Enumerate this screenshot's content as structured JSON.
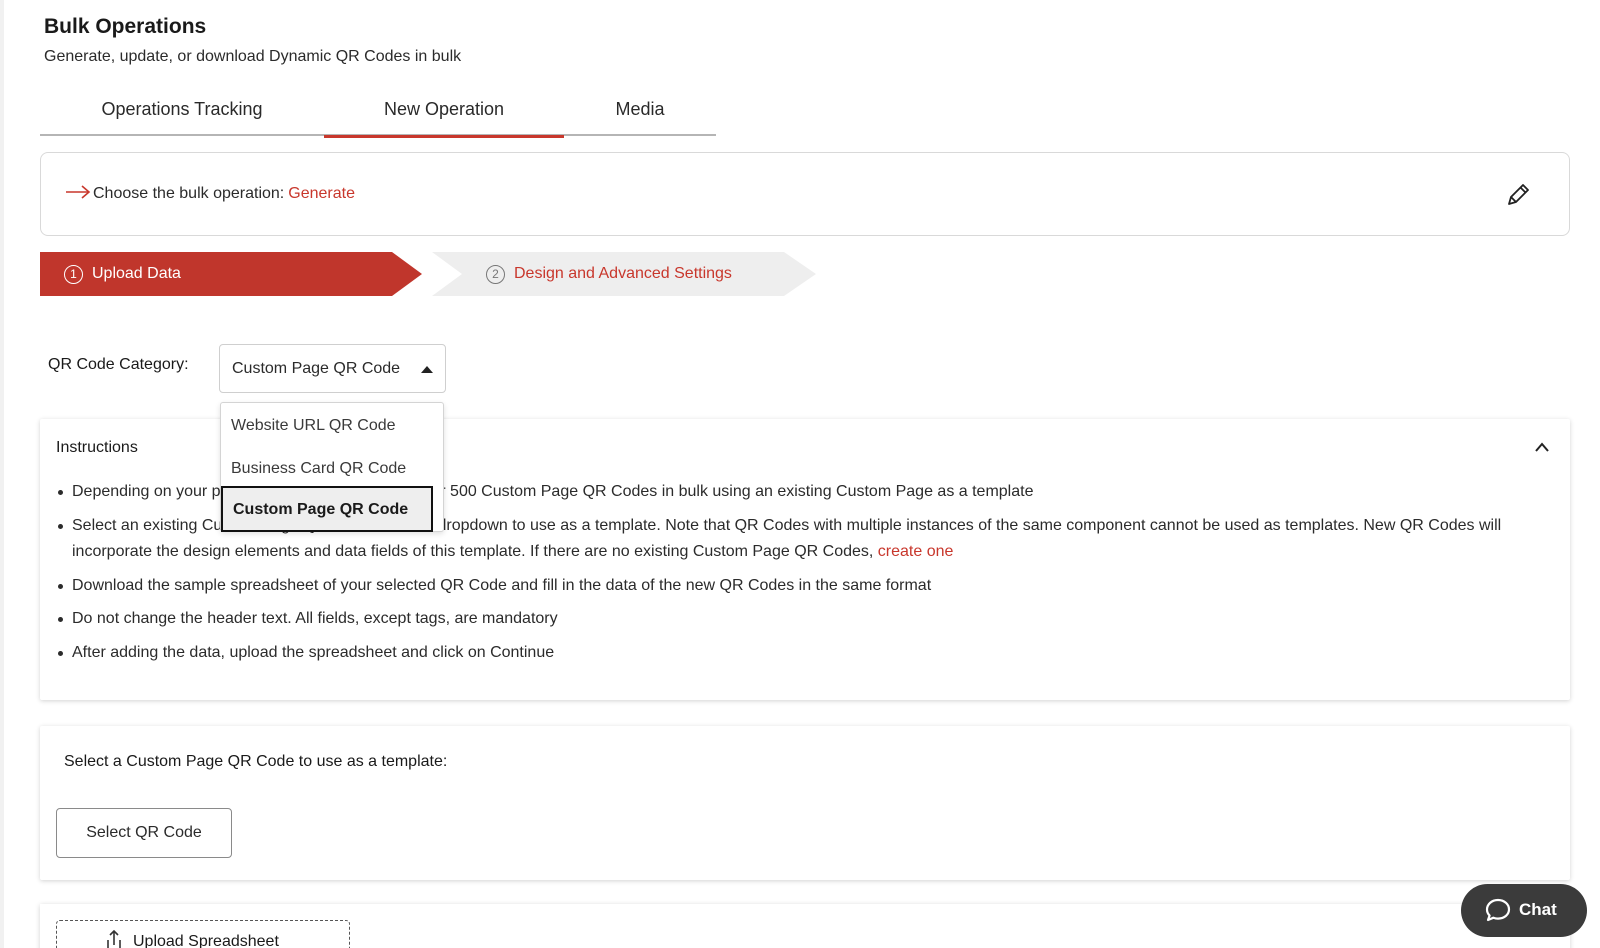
{
  "header": {
    "title": "Bulk Operations",
    "subtitle": "Generate, update, or download Dynamic QR Codes in bulk"
  },
  "tabs": [
    {
      "label": "Operations Tracking",
      "active": false
    },
    {
      "label": "New Operation",
      "active": true
    },
    {
      "label": "Media",
      "active": false
    }
  ],
  "operation": {
    "label": "Choose the bulk operation:",
    "value": "Generate",
    "arrow_icon": "arrow-right-icon",
    "edit_icon": "pencil-icon"
  },
  "stepper": [
    {
      "number": "1",
      "label": "Upload Data",
      "active": true
    },
    {
      "number": "2",
      "label": "Design and Advanced Settings",
      "active": false
    }
  ],
  "category": {
    "label": "QR Code Category:",
    "selected": "Custom Page QR Code",
    "options": [
      "Website URL QR Code",
      "Business Card QR Code",
      "Custom Page QR Code"
    ],
    "highlighted_index": 2
  },
  "instructions": {
    "title": "Instructions",
    "items": [
      "Depending on your plan, you can create up to 100 or 500 Custom Page QR Codes in bulk using an existing Custom Page as a template",
      "Select an existing Custom Page QR Code from the dropdown to use as a template. Note that QR Codes with multiple instances of the same component cannot be used as templates. New QR Codes will incorporate the design elements and data fields of this template. If there are no existing Custom Page QR Codes,",
      "Download the sample spreadsheet of your selected QR Code and fill in the data of the new QR Codes in the same format",
      "Do not change the header text. All fields, except tags, are mandatory",
      "After adding the data, upload the spreadsheet and click on Continue"
    ],
    "create_link": "create one"
  },
  "template": {
    "label": "Select a Custom Page QR Code to use as a template:",
    "button": "Select QR Code"
  },
  "upload": {
    "button": "Upload Spreadsheet",
    "icon": "upload-icon"
  },
  "chat": {
    "label": "Chat",
    "icon": "chat-bubble-icon"
  },
  "colors": {
    "accent": "#c8372c",
    "step_active_bg": "#c0362c",
    "step_inactive_bg": "#eeeeee",
    "chat_bg": "#3b3b3b"
  }
}
